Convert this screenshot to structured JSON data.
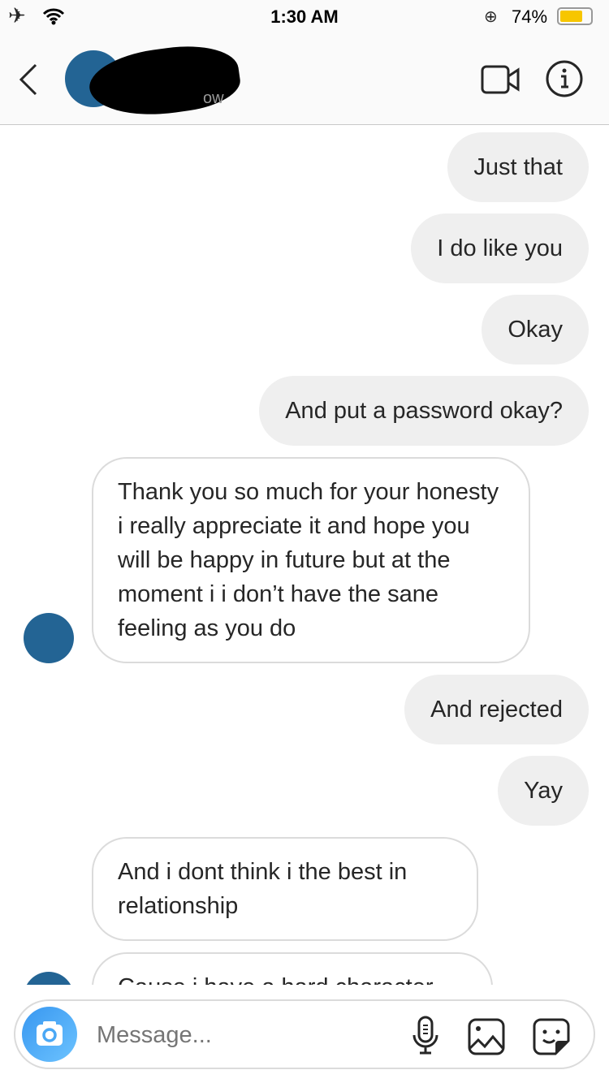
{
  "status_bar": {
    "time": "1:30 AM",
    "battery": "74%",
    "battery_level": 0.74,
    "battery_color": "#f7c600"
  },
  "header": {
    "subtitle_fragment": "ow",
    "avatar_color": "#236494"
  },
  "messages": [
    {
      "side": "sent",
      "text": "Just that"
    },
    {
      "side": "sent",
      "text": "I do like you"
    },
    {
      "side": "sent",
      "text": "Okay"
    },
    {
      "side": "sent",
      "text": "And put a password okay?"
    },
    {
      "side": "received",
      "text": "Thank you so much for your honesty i really appreciate it and hope you will be happy in future but at the moment i i don’t have the sane feeling as you do"
    },
    {
      "side": "sent",
      "text": "And rejected"
    },
    {
      "side": "sent",
      "text": "Yay"
    },
    {
      "side": "received",
      "text": "And i dont think i the best in relationship"
    },
    {
      "side": "received",
      "text": "Cause i have a hard character"
    }
  ],
  "composer": {
    "placeholder": "Message..."
  }
}
